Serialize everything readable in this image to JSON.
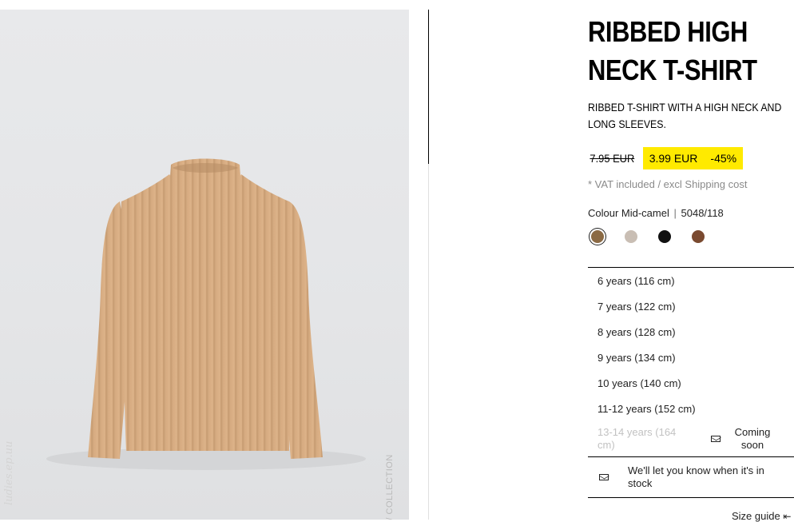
{
  "product": {
    "title_line1": "RIBBED HIGH",
    "title_line2": "NECK T-SHIRT",
    "description": "RIBBED T-SHIRT WITH A HIGH NECK AND LONG SLEEVES.",
    "old_price": "7.95 EUR",
    "sale_price": "3.99 EUR",
    "discount": "-45%",
    "vat_note": "* VAT included / excl Shipping cost",
    "colour_label": "Colour Mid-camel",
    "colour_sep": "|",
    "ref": "5048/118",
    "swatch_colors": [
      "#8b6a44",
      "#c9beb4",
      "#111111",
      "#7a4a30"
    ]
  },
  "sizes": [
    {
      "label": "6 years (116 cm)"
    },
    {
      "label": "7 years (122 cm)"
    },
    {
      "label": "8 years (128 cm)"
    },
    {
      "label": "9 years (134 cm)"
    },
    {
      "label": "10 years (140 cm)"
    },
    {
      "label": "11-12 years (152 cm)"
    },
    {
      "label": "13-14 years (164 cm)",
      "status": "Coming soon"
    }
  ],
  "notify": {
    "label": "We'll let you know when it's in stock"
  },
  "size_guide": "Size guide",
  "image": {
    "side_watermark": "E / COLLECTION",
    "left_watermark": "ludies.ep.uu"
  },
  "colors": {
    "sale_highlight": "#ffea00",
    "garment": "#d9ae83"
  }
}
